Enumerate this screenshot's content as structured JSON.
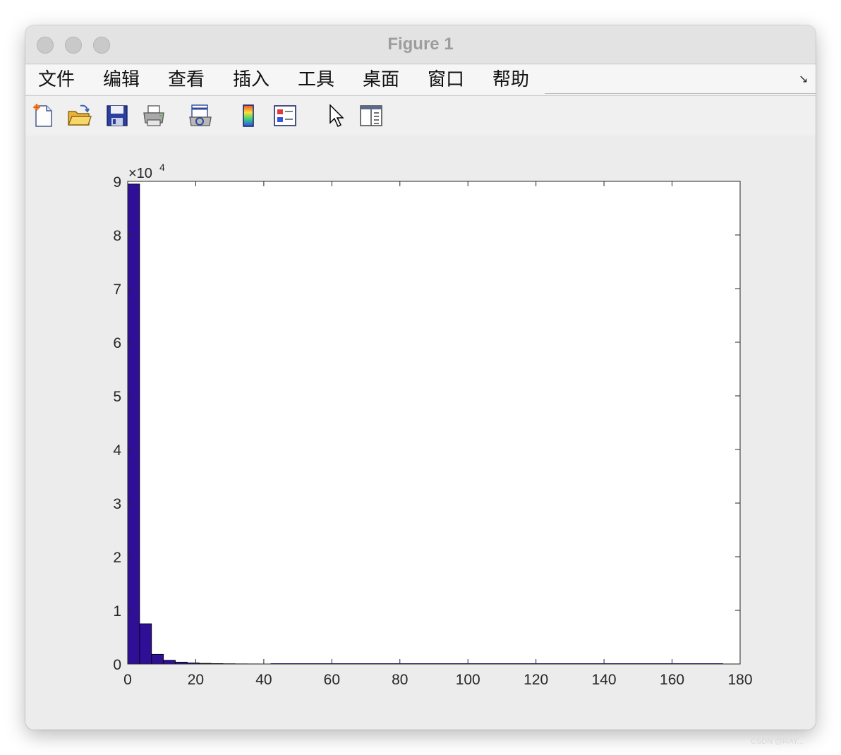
{
  "window": {
    "title": "Figure 1"
  },
  "menu": {
    "items": [
      "文件",
      "编辑",
      "查看",
      "插入",
      "工具",
      "桌面",
      "窗口",
      "帮助"
    ],
    "overflow_arrow": "↘"
  },
  "toolbar": {
    "icons": [
      "new-figure-icon",
      "open-file-icon",
      "save-icon",
      "print-icon",
      "print-preview-icon",
      "insert-colorbar-icon",
      "insert-legend-icon",
      "edit-plot-pointer-icon",
      "property-editor-icon"
    ]
  },
  "chart_data": {
    "type": "bar",
    "subtype": "histogram",
    "bar_color": "#2e0f96",
    "bar_edge_color": "#000000",
    "y_exponent_label": "×10",
    "y_exponent_power": "4",
    "xlim": [
      0,
      180
    ],
    "ylim": [
      0,
      90000
    ],
    "x_ticks": [
      "0",
      "20",
      "40",
      "60",
      "80",
      "100",
      "120",
      "140",
      "160",
      "180"
    ],
    "y_ticks": [
      "0",
      "1",
      "2",
      "3",
      "4",
      "5",
      "6",
      "7",
      "8",
      "9"
    ],
    "bin_width": 3.5,
    "bin_starts": [
      0,
      3.5,
      7,
      10.5,
      14,
      17.5,
      21,
      24.5,
      28,
      31.5,
      35,
      38.5
    ],
    "values": [
      89500,
      7500,
      1800,
      700,
      350,
      200,
      120,
      80,
      50,
      30,
      20,
      10
    ],
    "x_data_max": 175,
    "grid": false
  },
  "watermark": "CSDN @RAY..."
}
